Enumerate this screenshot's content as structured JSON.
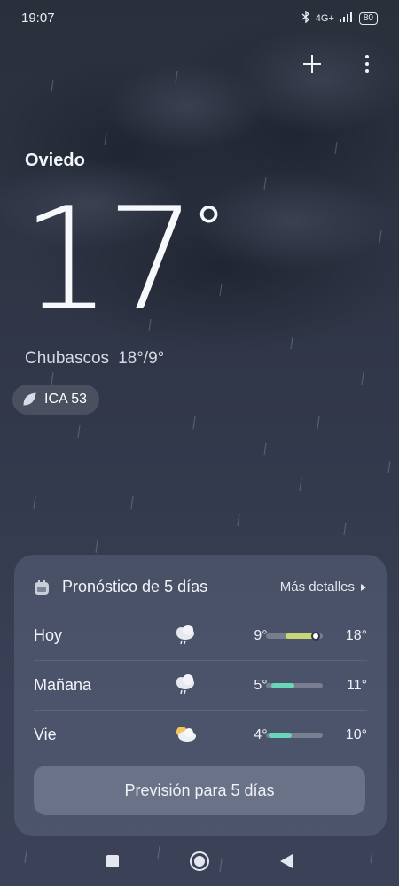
{
  "status": {
    "time": "19:07",
    "network": "4G+",
    "battery": "80"
  },
  "location": {
    "city": "Oviedo"
  },
  "current": {
    "temperature": "17",
    "degree_symbol": "°",
    "condition": "Chubascos",
    "high_low": "18°/9°"
  },
  "aqi": {
    "label": "ICA 53"
  },
  "forecast": {
    "title": "Pronóstico de 5 días",
    "more_label": "Más detalles",
    "button_label": "Previsión para 5 días",
    "days": [
      {
        "name": "Hoy",
        "icon": "rain-cloud-icon",
        "min": "9°",
        "max": "18°",
        "bar_start": 0.35,
        "bar_end": 0.9,
        "bar_color": "#c7d676",
        "dot": 0.88
      },
      {
        "name": "Mañana",
        "icon": "rain-cloud-icon",
        "min": "5°",
        "max": "11°",
        "bar_start": 0.1,
        "bar_end": 0.5,
        "bar_color": "#68d6b8"
      },
      {
        "name": "Vie",
        "icon": "partly-cloudy-icon",
        "min": "4°",
        "max": "10°",
        "bar_start": 0.05,
        "bar_end": 0.45,
        "bar_color": "#68d6b8"
      }
    ]
  },
  "colors": {
    "background": "#333a4d",
    "accent_green": "#68d6b8",
    "accent_yellow": "#c7d676"
  }
}
